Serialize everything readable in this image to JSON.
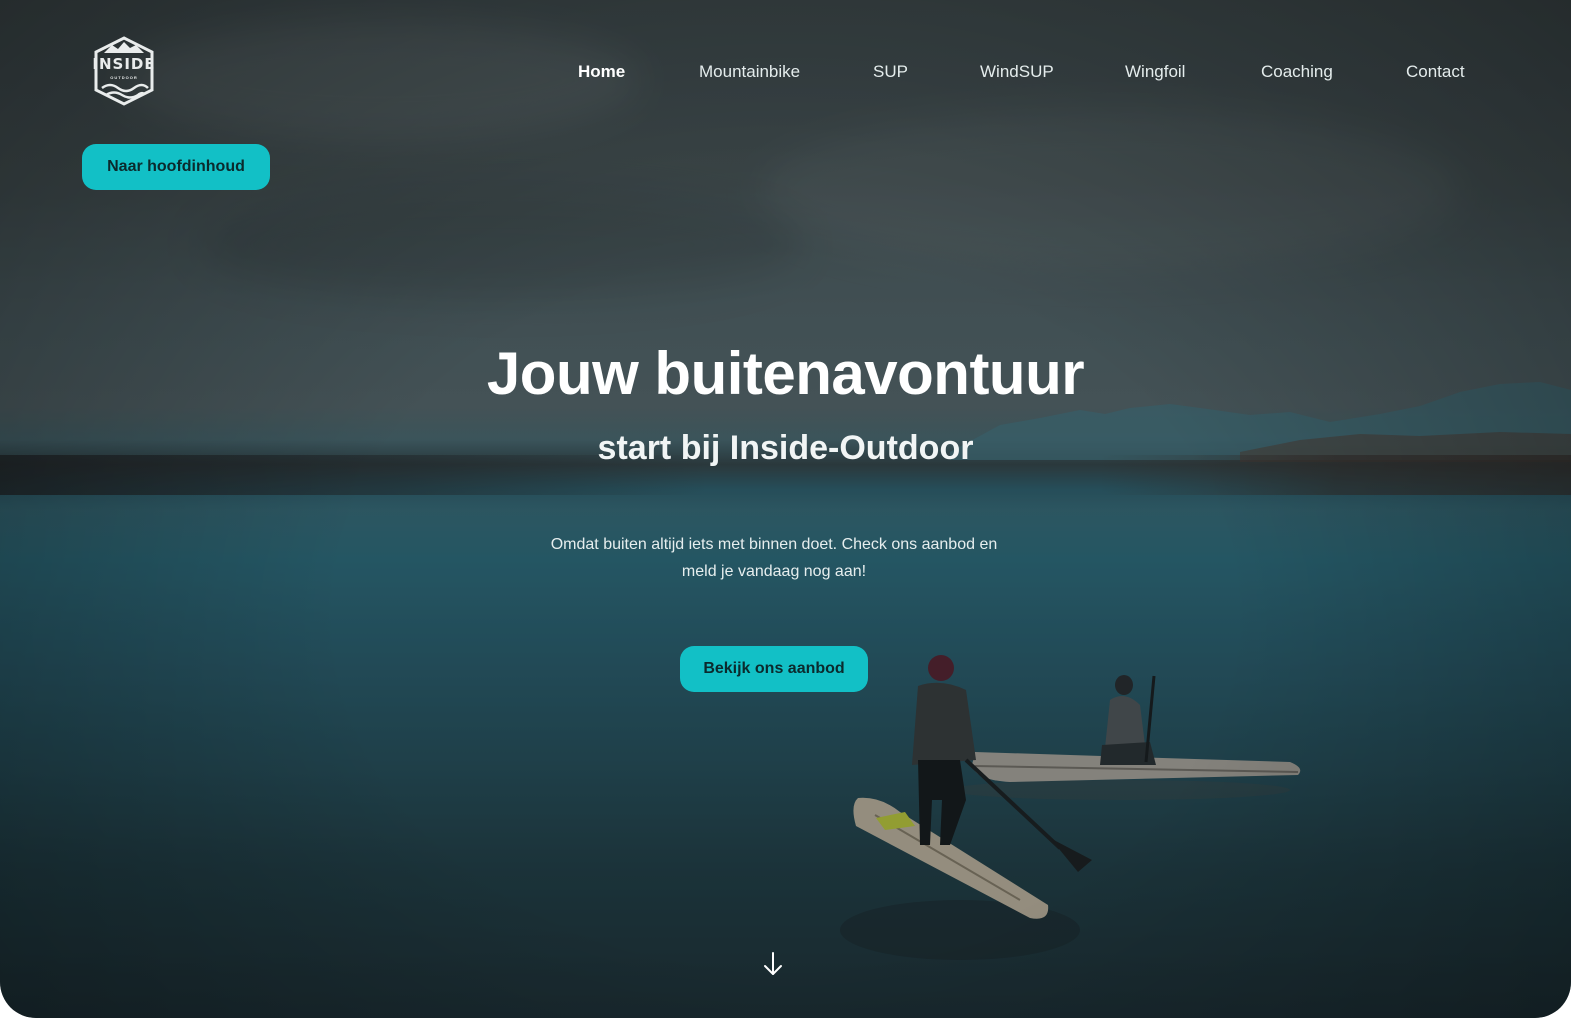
{
  "brand": {
    "logo_text": "INSIDE",
    "logo_subtext": "OUTDOOR"
  },
  "nav": {
    "items": [
      {
        "label": "Home",
        "active": true
      },
      {
        "label": "Mountainbike",
        "active": false
      },
      {
        "label": "SUP",
        "active": false
      },
      {
        "label": "WindSUP",
        "active": false
      },
      {
        "label": "Wingfoil",
        "active": false
      },
      {
        "label": "Coaching",
        "active": false
      },
      {
        "label": "Contact",
        "active": false
      }
    ]
  },
  "skip_link": {
    "label": "Naar hoofdinhoud"
  },
  "hero": {
    "title": "Jouw buitenavontuur",
    "subtitle": "start bij Inside-Outdoor",
    "text": "Omdat buiten altijd iets met binnen doet. Check ons aanbod en meld je vandaag nog aan!",
    "cta_label": "Bekijk ons aanbod",
    "scroll_icon": "arrow-down-icon"
  },
  "colors": {
    "accent": "#12c0c6",
    "button_text": "#0b2a2d"
  }
}
